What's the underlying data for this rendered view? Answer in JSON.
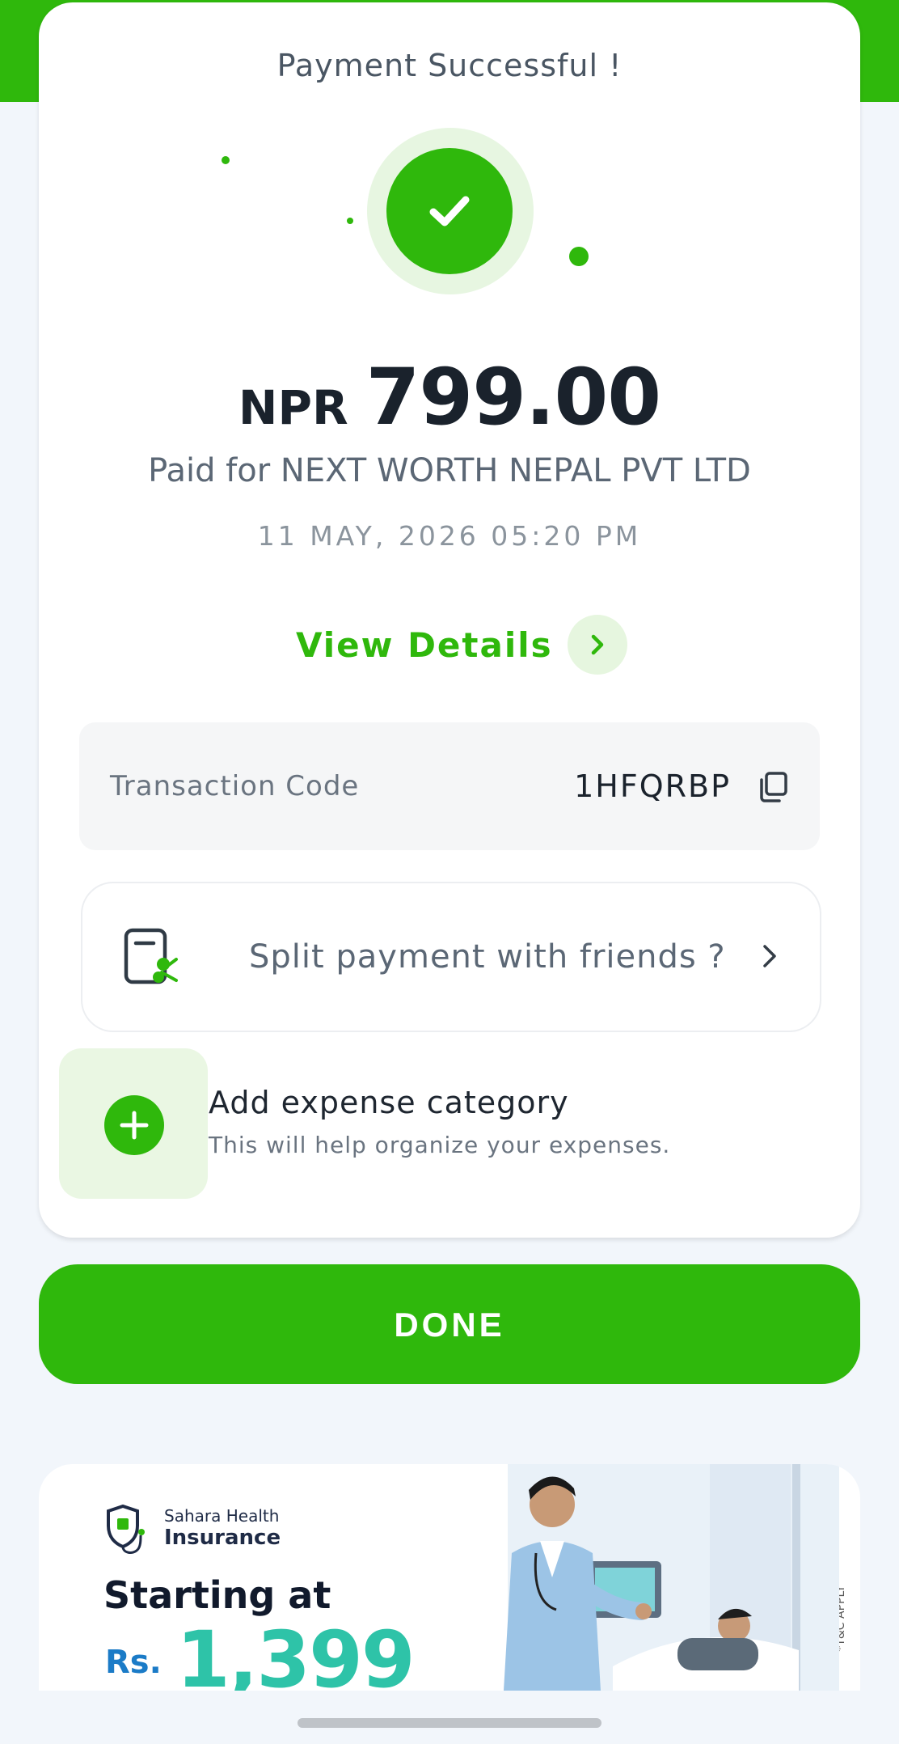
{
  "header": {
    "title": "Payment Successful !"
  },
  "payment": {
    "currency": "NPR",
    "amount": "799.00",
    "paid_for": "Paid for NEXT WORTH NEPAL PVT LTD",
    "datetime": "11 MAY, 2026 05:20 PM",
    "view_details": "View Details"
  },
  "transaction": {
    "label": "Transaction Code",
    "code": "1HFQRBP"
  },
  "split": {
    "label": "Split payment with friends ?"
  },
  "expense": {
    "title": "Add expense category",
    "subtitle": "This will help organize your expenses."
  },
  "done_label": "DONE",
  "banner": {
    "brand_line1": "Sahara Health",
    "brand_line2": "Insurance",
    "headline": "Starting at",
    "currency": "Rs.",
    "price": "1,399",
    "terms": "*T&C APPLY"
  },
  "colors": {
    "accent": "#2fb80c",
    "price": "#2ec3a8"
  }
}
